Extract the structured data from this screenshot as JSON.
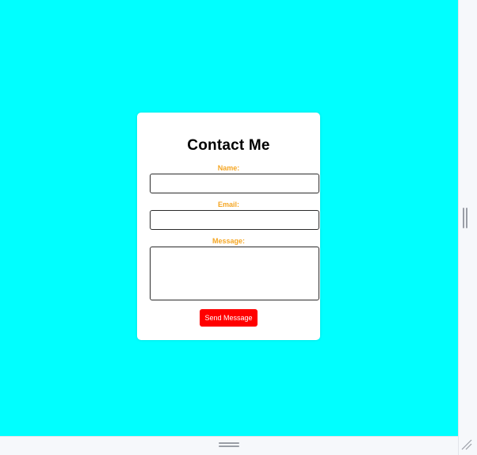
{
  "form": {
    "title": "Contact Me",
    "name_label": "Name:",
    "name_value": "",
    "email_label": "Email:",
    "email_value": "",
    "message_label": "Message:",
    "message_value": "",
    "submit_label": "Send Message"
  },
  "colors": {
    "page_background": "#00ffff",
    "card_background": "#ffffff",
    "label_color": "#f5a623",
    "button_background": "#ff0000",
    "button_text": "#ffffff"
  },
  "icons": {
    "vertical_splitter": "splitter-vertical-icon",
    "horizontal_splitter": "splitter-horizontal-icon",
    "resize": "resize-grip-icon"
  }
}
